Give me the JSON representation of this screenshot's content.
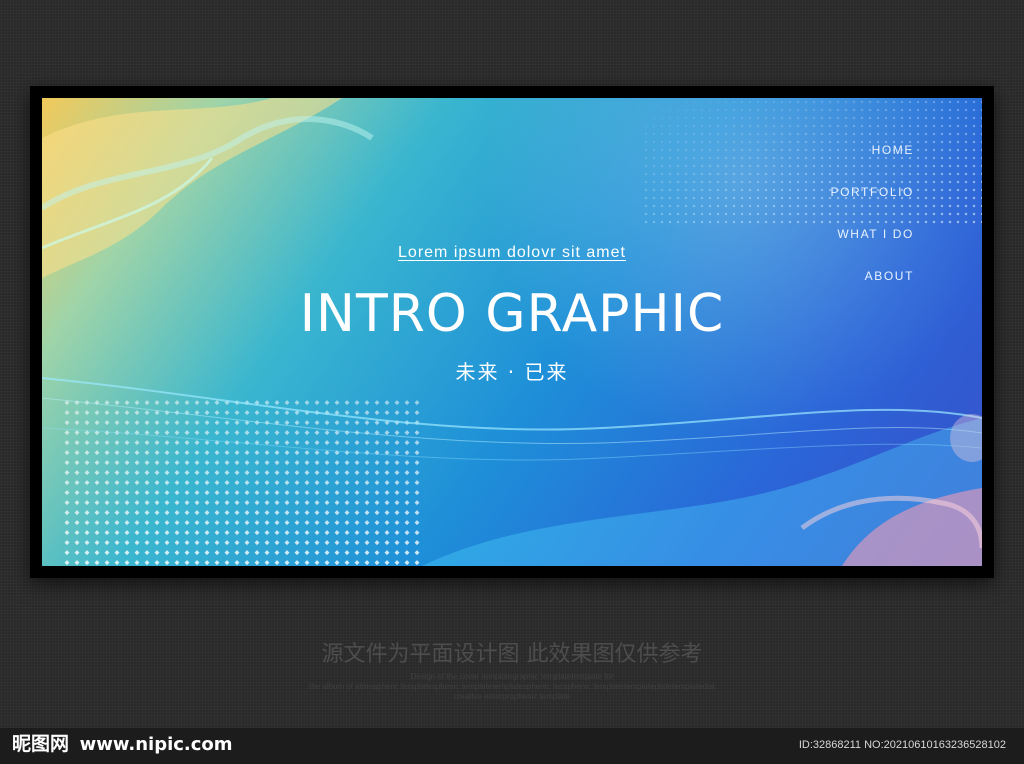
{
  "banner": {
    "nav": [
      "HOME",
      "PORTFOLIO",
      "WHAT I DO",
      "ABOUT"
    ],
    "subtitle": "Lorem ipsum dolovr sit amet",
    "title": "INTRO GRAPHIC",
    "tagline": "未来 · 已来"
  },
  "page": {
    "caption": "源文件为平面设计图 此效果图仅供参考",
    "small_text": [
      "Design of the cover templategraphic templatetemplate for",
      "the album of atmospheric templatesphenic templatetemplatesphenic tecsphenic templatetemplateplatetemplatedist",
      "creative enterprophenic template"
    ]
  },
  "footer": {
    "logo": "昵图网",
    "url": "www.nipic.com",
    "id_text": "ID:32868211 NO:20210610163236528102"
  },
  "colors": {
    "background": "#2a2a2a",
    "banner_start": "#f2c95a",
    "banner_mid": "#1e8fd8",
    "banner_end": "#3a4ec8",
    "text": "#ffffff"
  }
}
